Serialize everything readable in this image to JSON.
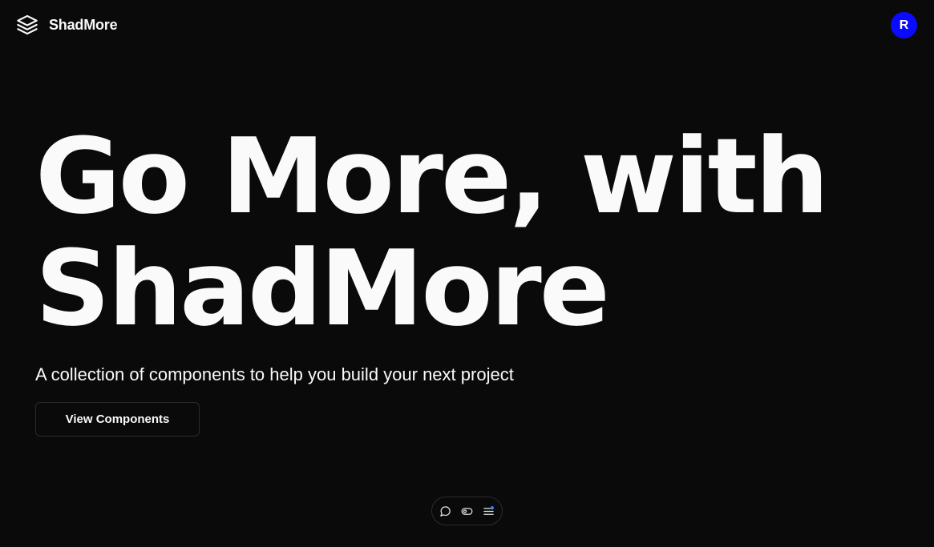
{
  "header": {
    "brand_name": "ShadMore",
    "brand_icon": "layers-icon",
    "avatar_initial": "R",
    "avatar_color": "#0a0aff"
  },
  "hero": {
    "title_line1": "Go More, with",
    "title_line2": "ShadMore",
    "subtitle": "A collection of components to help you build your next project",
    "cta_label": "View Components"
  },
  "dock": {
    "items": [
      {
        "icon": "chat-bubble-icon"
      },
      {
        "icon": "toggle-icon"
      },
      {
        "icon": "list-settings-icon"
      }
    ]
  },
  "colors": {
    "background": "#0a0a0a",
    "foreground": "#fafafa",
    "border": "#2b2b2b",
    "accent": "#0a0aff"
  }
}
